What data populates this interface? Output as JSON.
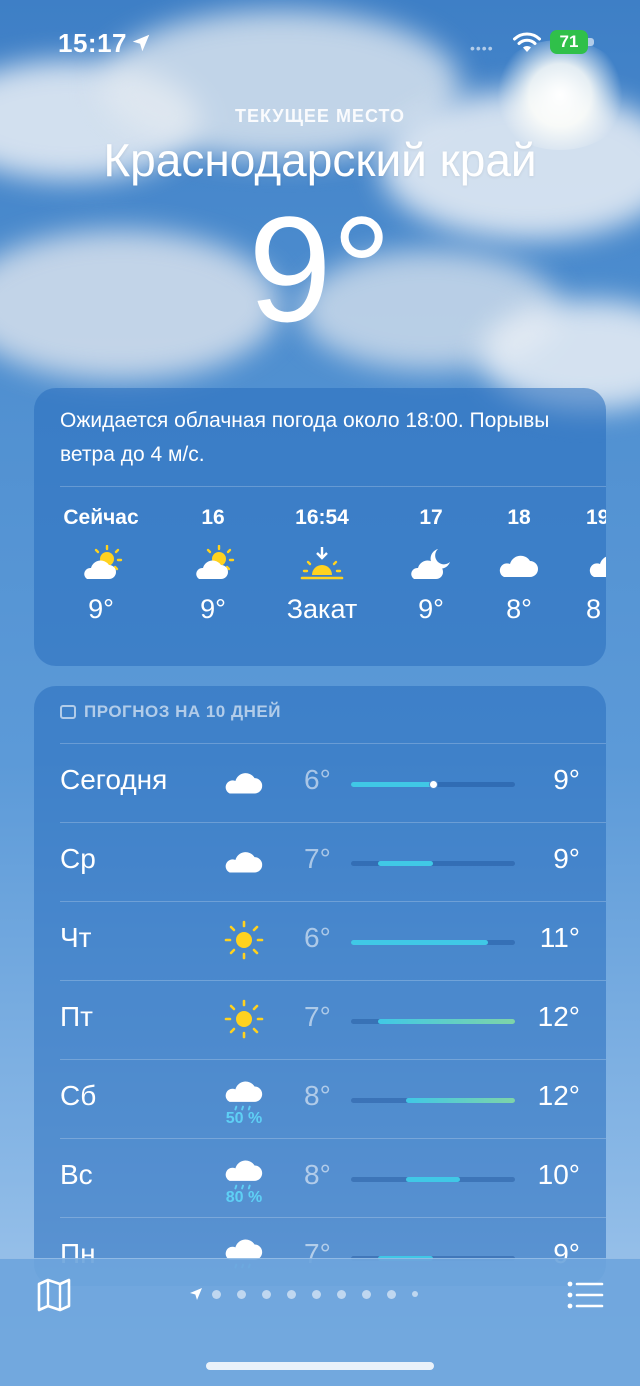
{
  "status_bar": {
    "time": "15:17",
    "battery": "71"
  },
  "header": {
    "current_place_label": "ТЕКУЩЕЕ МЕСТО",
    "city": "Краснодарский край",
    "temperature": "9°"
  },
  "hourly_card": {
    "summary": "Ожидается облачная погода около 18:00. Порывы ветра до 4 м/с.",
    "hours": [
      {
        "label": "Сейчас",
        "icon": "partly-sunny-icon",
        "temp": "9°"
      },
      {
        "label": "16",
        "icon": "partly-sunny-icon",
        "temp": "9°"
      },
      {
        "label": "16:54",
        "icon": "sunset-icon",
        "temp": "Закат"
      },
      {
        "label": "17",
        "icon": "partly-cloudy-night-icon",
        "temp": "9°"
      },
      {
        "label": "18",
        "icon": "cloud-icon",
        "temp": "8°"
      },
      {
        "label": "19",
        "icon": "cloud-icon",
        "temp": "8"
      }
    ]
  },
  "forecast": {
    "header": "ПРОГНОЗ НА 10 ДНЕЙ",
    "range_min": 6,
    "range_max": 12,
    "days": [
      {
        "day": "Сегодня",
        "icon": "cloud-icon",
        "precip": "",
        "low": "6°",
        "high": "9°",
        "low_value": 6,
        "high_value": 9,
        "current": 9
      },
      {
        "day": "Ср",
        "icon": "cloud-icon",
        "precip": "",
        "low": "7°",
        "high": "9°",
        "low_value": 7,
        "high_value": 9
      },
      {
        "day": "Чт",
        "icon": "sun-icon",
        "precip": "",
        "low": "6°",
        "high": "11°",
        "low_value": 6,
        "high_value": 11
      },
      {
        "day": "Пт",
        "icon": "sun-icon",
        "precip": "",
        "low": "7°",
        "high": "12°",
        "low_value": 7,
        "high_value": 12
      },
      {
        "day": "Сб",
        "icon": "cloud-rain-icon",
        "precip": "50 %",
        "low": "8°",
        "high": "12°",
        "low_value": 8,
        "high_value": 12
      },
      {
        "day": "Вс",
        "icon": "cloud-rain-icon",
        "precip": "80 %",
        "low": "8°",
        "high": "10°",
        "low_value": 8,
        "high_value": 10
      },
      {
        "day": "Пн",
        "icon": "cloud-rain-icon",
        "precip": "",
        "low": "7°",
        "high": "9°",
        "low_value": 7,
        "high_value": 9
      }
    ]
  },
  "colors": {
    "bar_cool": "#40c8e6",
    "bar_warm": "#7ed4a8",
    "precip": "#5ed0f5"
  }
}
